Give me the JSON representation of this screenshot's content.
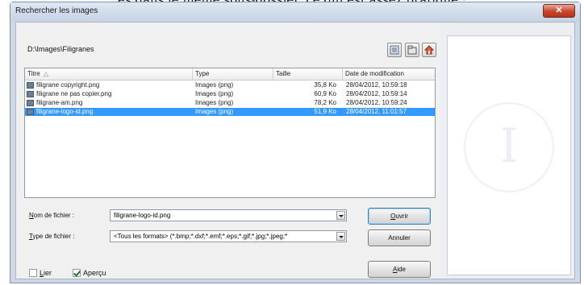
{
  "page": {
    "caption": "és dans le même sous-dossier, ce qui est assez pratique :"
  },
  "window": {
    "title": "Rechercher les images",
    "close_glyph": "✕"
  },
  "location": {
    "path": "D:\\Images\\Filigranes"
  },
  "list": {
    "columns": [
      "Titre",
      "Type",
      "Taille",
      "Date de modification"
    ],
    "sort_glyph": "△",
    "rows": [
      {
        "name": "filigrane copyright.png",
        "type": "Images (png)",
        "size": "35,8 Ko",
        "date": "28/04/2012, 10:59:18",
        "selected": false
      },
      {
        "name": "filigrane ne pas copier.png",
        "type": "Images (png)",
        "size": "60,9 Ko",
        "date": "28/04/2012, 10:59:14",
        "selected": false
      },
      {
        "name": "filigrane-am.png",
        "type": "Images (png)",
        "size": "78,2 Ko",
        "date": "28/04/2012, 10:59:24",
        "selected": false
      },
      {
        "name": "filigrane-logo-id.png",
        "type": "Images (png)",
        "size": "51,9 Ko",
        "date": "28/04/2012, 11:01:57",
        "selected": true
      }
    ]
  },
  "form": {
    "filename_label_accel": "N",
    "filename_label_rest": "om de fichier :",
    "filename_value": "filigrane-logo-id.png",
    "filetype_label_accel": "T",
    "filetype_label_rest": "ype de fichier :",
    "filetype_value": "<Tous les formats> (*.bmp;*.dxf;*.emf;*.eps;*.gif;*.jpg;*.jpeg;*"
  },
  "buttons": {
    "open_accel": "O",
    "open_rest": "uvrir",
    "cancel": "Annuler",
    "help_accel": "A",
    "help_rest": "ide"
  },
  "options": {
    "link_accel": "L",
    "link_rest": "ier",
    "link_checked": false,
    "preview_label": "Aperçu",
    "preview_checked": true
  },
  "preview": {
    "watermark_letter": "I"
  },
  "colors": {
    "selection": "#3399ff"
  }
}
